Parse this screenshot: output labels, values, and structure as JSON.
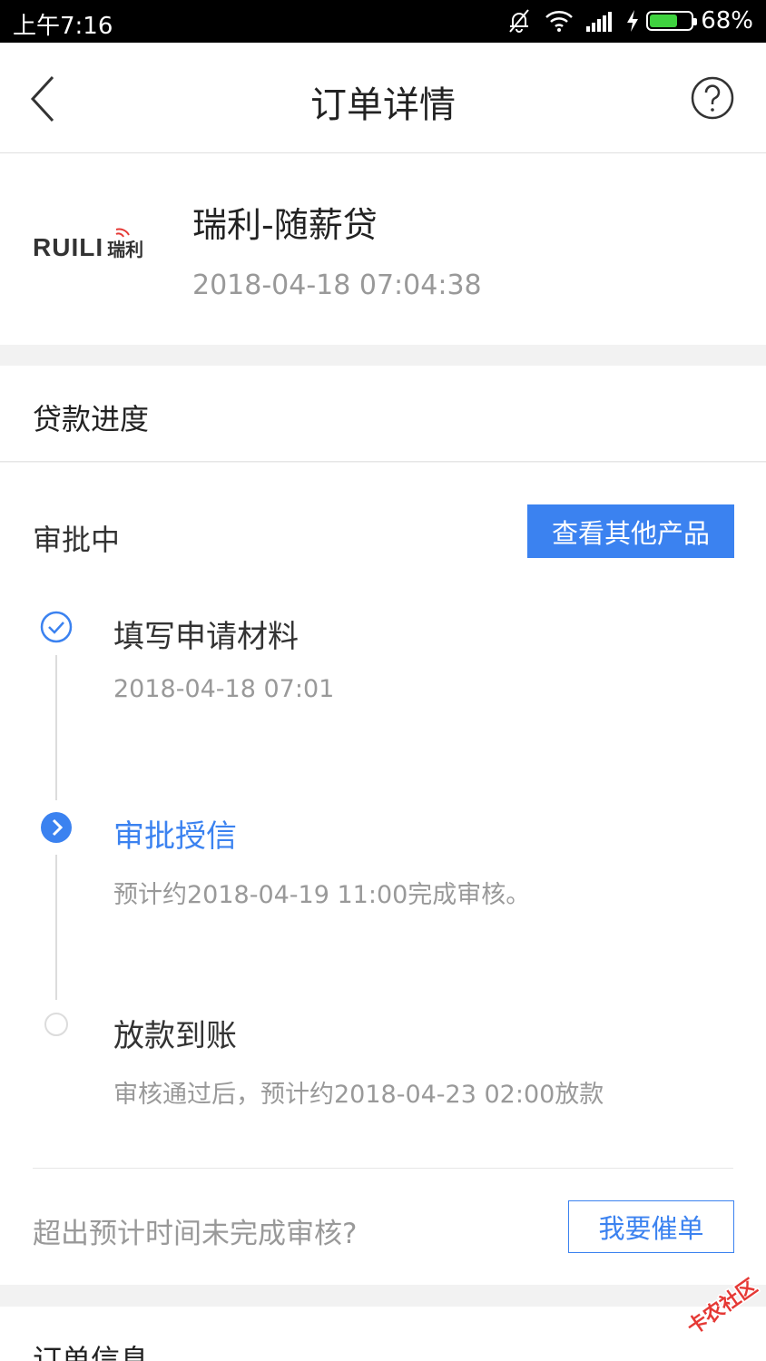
{
  "status_bar": {
    "time": "上午7:16",
    "battery": "68%",
    "battery_level": 0.68,
    "battery_color": "#3fd23f"
  },
  "nav": {
    "title": "订单详情",
    "back_icon": "chevron-left-icon",
    "help_icon": "question-circle-icon"
  },
  "product": {
    "name": "瑞利-随薪贷",
    "date": "2018-04-18 07:04:38",
    "logo_text": "RUILI",
    "logo_cn": "瑞利"
  },
  "progress": {
    "section_label": "贷款进度",
    "status": "审批中",
    "other_products_button": "查看其他产品",
    "steps": [
      {
        "title": "填写申请材料",
        "desc": "2018-04-18 07:01",
        "state": "done"
      },
      {
        "title": "审批授信",
        "desc": "预计约2018-04-19 11:00完成审核。",
        "state": "active"
      },
      {
        "title": "放款到账",
        "desc": "审核通过后，预计约2018-04-23 02:00放款",
        "state": "pending"
      }
    ],
    "overdue_question": "超出预计时间未完成审核?",
    "urge_button": "我要催单"
  },
  "order_info": {
    "label": "订单信息"
  },
  "colors": {
    "accent": "#3b82f0",
    "muted_text": "#999999"
  }
}
